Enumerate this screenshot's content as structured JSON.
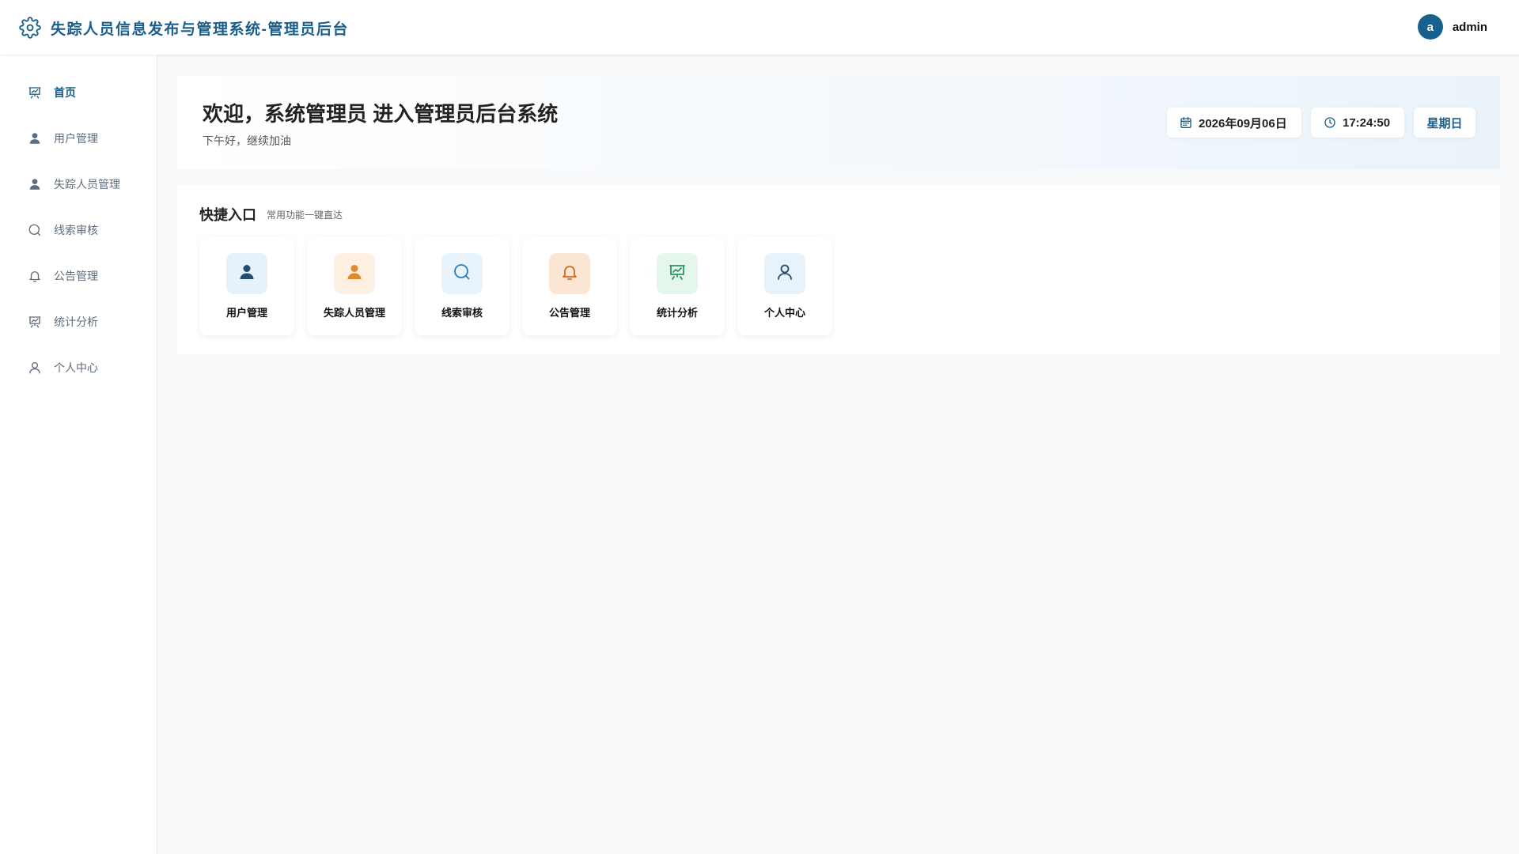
{
  "header": {
    "app_title": "失踪人员信息发布与管理系统-管理员后台",
    "user": {
      "avatar_letter": "a",
      "name": "admin"
    }
  },
  "sidebar": {
    "items": [
      {
        "label": "首页",
        "icon": "presentation-chart-icon",
        "active": true
      },
      {
        "label": "用户管理",
        "icon": "user-filled-icon"
      },
      {
        "label": "失踪人员管理",
        "icon": "user-filled-icon"
      },
      {
        "label": "线索审核",
        "icon": "search-icon"
      },
      {
        "label": "公告管理",
        "icon": "bell-icon"
      },
      {
        "label": "统计分析",
        "icon": "presentation-chart-icon"
      },
      {
        "label": "个人中心",
        "icon": "user-outline-icon"
      }
    ]
  },
  "welcome": {
    "title": "欢迎，系统管理员 进入管理员后台系统",
    "subtitle": "下午好，继续加油",
    "date": "2026年09月06日",
    "time": "17:24:50",
    "weekday": "星期日"
  },
  "quick": {
    "title": "快捷入口",
    "subtitle": "常用功能一键直达",
    "cards": [
      {
        "label": "用户管理",
        "icon": "user-filled-icon",
        "bg": "#e6f1fa",
        "color": "#1f4e6e"
      },
      {
        "label": "失踪人员管理",
        "icon": "user-filled-icon",
        "bg": "#fdf0e3",
        "color": "#e08a2e"
      },
      {
        "label": "线索审核",
        "icon": "search-icon",
        "bg": "#e9f3fb",
        "color": "#2e7bb5"
      },
      {
        "label": "公告管理",
        "icon": "bell-icon",
        "bg": "#fbe6d3",
        "color": "#d46a1f"
      },
      {
        "label": "统计分析",
        "icon": "presentation-chart-icon",
        "bg": "#e5f6ec",
        "color": "#2e9160"
      },
      {
        "label": "个人中心",
        "icon": "user-outline-icon",
        "bg": "#e8f2fb",
        "color": "#1f4e6e"
      }
    ]
  },
  "colors": {
    "primary": "#1a5f8a",
    "page_bg": "#f7f9fb",
    "muted_text": "#5d6d7e"
  }
}
